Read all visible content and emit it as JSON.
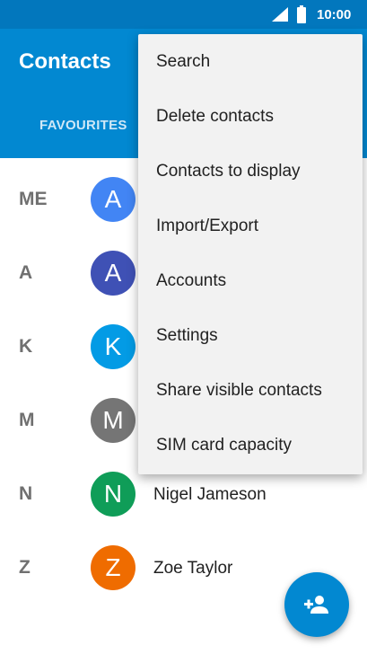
{
  "status_bar": {
    "time": "10:00"
  },
  "app_bar": {
    "title": "Contacts",
    "tab_favourites": "FAVOURITES"
  },
  "contacts": [
    {
      "section": "ME",
      "initial": "A",
      "name": "",
      "color": "#4285f4"
    },
    {
      "section": "A",
      "initial": "A",
      "name": "",
      "color": "#3f51b5"
    },
    {
      "section": "K",
      "initial": "K",
      "name": "",
      "color": "#039be5"
    },
    {
      "section": "M",
      "initial": "M",
      "name": "",
      "color": "#757575"
    },
    {
      "section": "N",
      "initial": "N",
      "name": "Nigel Jameson",
      "color": "#0f9d58"
    },
    {
      "section": "Z",
      "initial": "Z",
      "name": "Zoe Taylor",
      "color": "#ef6c00"
    }
  ],
  "menu": {
    "items": [
      "Search",
      "Delete contacts",
      "Contacts to display",
      "Import/Export",
      "Accounts",
      "Settings",
      "Share visible contacts",
      "SIM card capacity"
    ]
  },
  "fab": {
    "icon": "add-contact-icon"
  },
  "colors": {
    "primary": "#0288d1",
    "primary_dark": "#0277bd"
  }
}
